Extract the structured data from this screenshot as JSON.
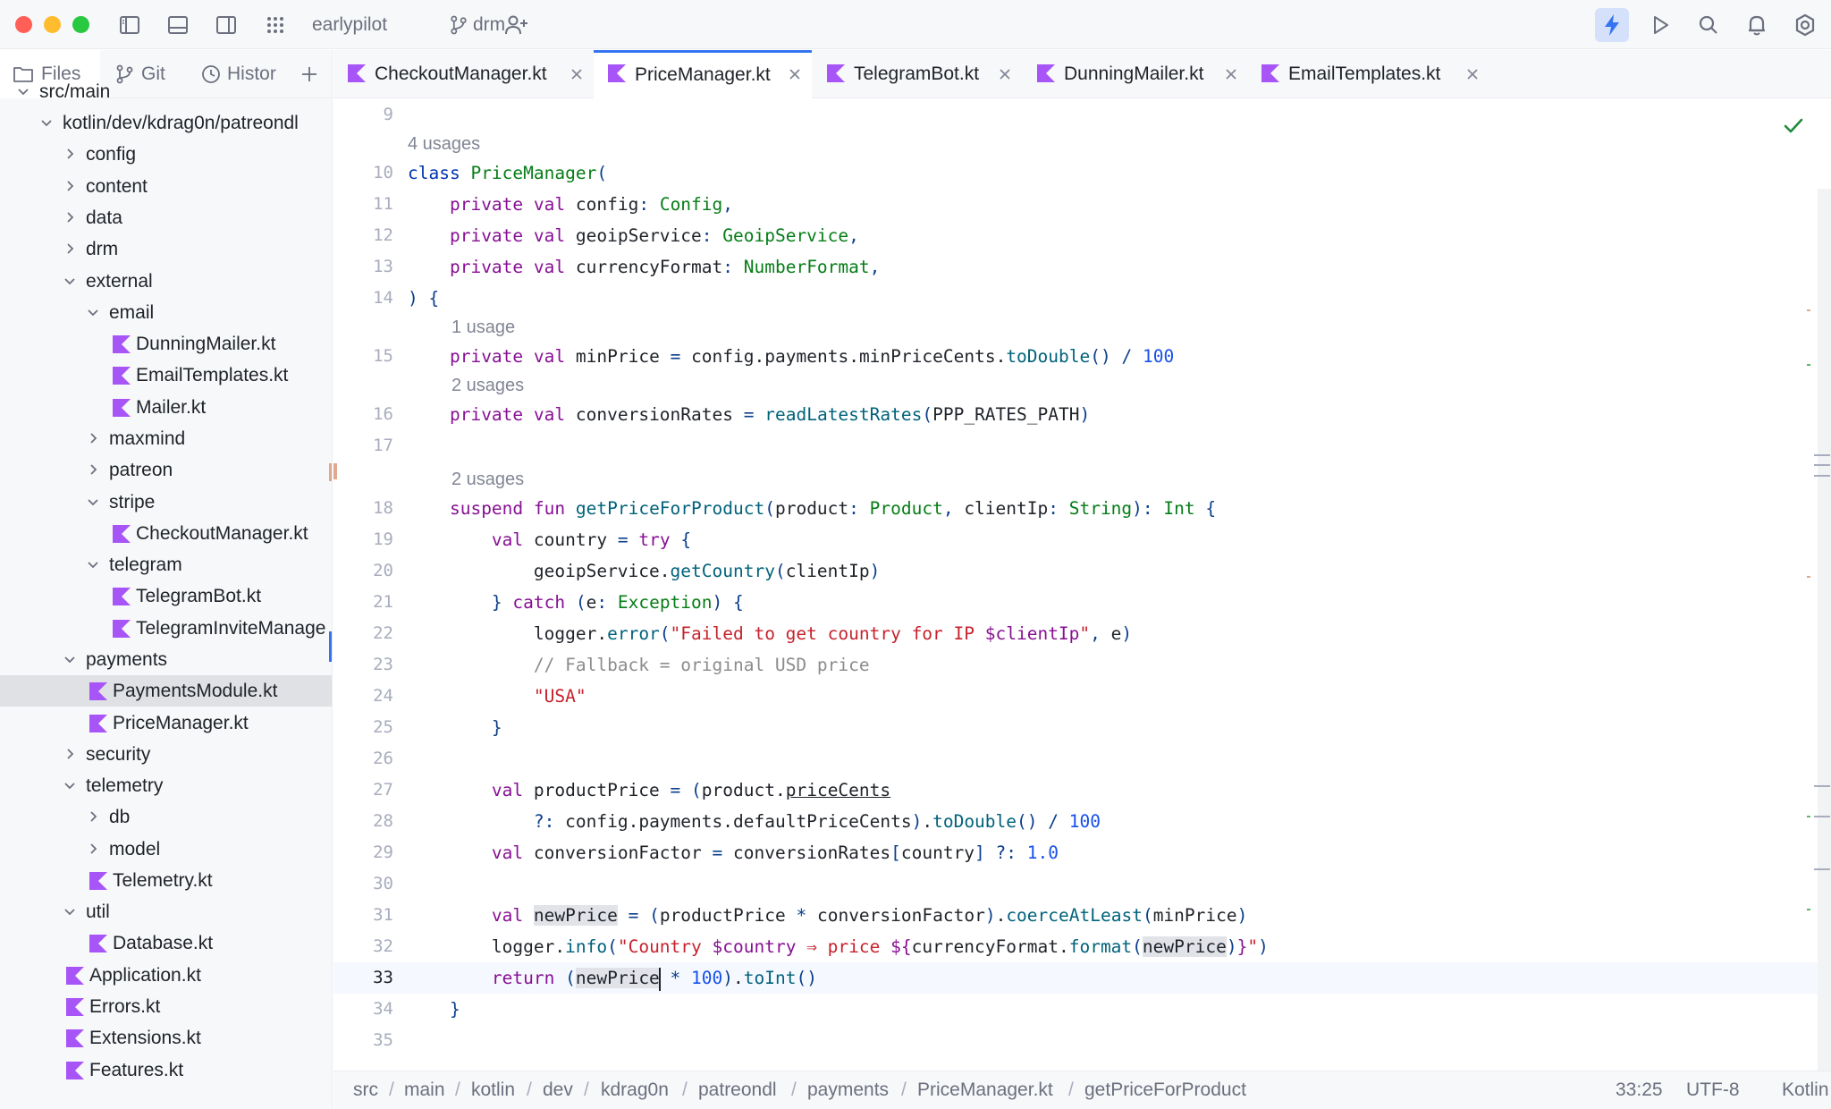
{
  "titlebar": {
    "project": "earlypilot",
    "branch": "drm"
  },
  "panel_tabs": [
    {
      "label": "Files",
      "icon": "folder-icon"
    },
    {
      "label": "Git",
      "icon": "git-branch-icon"
    },
    {
      "label": "Histor",
      "icon": "history-icon"
    }
  ],
  "tree": [
    {
      "label": "src/main",
      "type": "folder",
      "expanded": true,
      "depth": 0
    },
    {
      "label": "kotlin/dev/kdrag0n/patreondl",
      "type": "folder",
      "expanded": true,
      "depth": 1
    },
    {
      "label": "config",
      "type": "folder",
      "expanded": false,
      "depth": 2
    },
    {
      "label": "content",
      "type": "folder",
      "expanded": false,
      "depth": 2
    },
    {
      "label": "data",
      "type": "folder",
      "expanded": false,
      "depth": 2
    },
    {
      "label": "drm",
      "type": "folder",
      "expanded": false,
      "depth": 2
    },
    {
      "label": "external",
      "type": "folder",
      "expanded": true,
      "depth": 2
    },
    {
      "label": "email",
      "type": "folder",
      "expanded": true,
      "depth": 3
    },
    {
      "label": "DunningMailer.kt",
      "type": "file",
      "depth": 4
    },
    {
      "label": "EmailTemplates.kt",
      "type": "file",
      "depth": 4
    },
    {
      "label": "Mailer.kt",
      "type": "file",
      "depth": 4
    },
    {
      "label": "maxmind",
      "type": "folder",
      "expanded": false,
      "depth": 3
    },
    {
      "label": "patreon",
      "type": "folder",
      "expanded": false,
      "depth": 3
    },
    {
      "label": "stripe",
      "type": "folder",
      "expanded": true,
      "depth": 3
    },
    {
      "label": "CheckoutManager.kt",
      "type": "file",
      "depth": 4
    },
    {
      "label": "telegram",
      "type": "folder",
      "expanded": true,
      "depth": 3
    },
    {
      "label": "TelegramBot.kt",
      "type": "file",
      "depth": 4
    },
    {
      "label": "TelegramInviteManage",
      "type": "file",
      "depth": 4
    },
    {
      "label": "payments",
      "type": "folder",
      "expanded": true,
      "depth": 2
    },
    {
      "label": "PaymentsModule.kt",
      "type": "file",
      "depth": 3,
      "state": "hover"
    },
    {
      "label": "PriceManager.kt",
      "type": "file",
      "depth": 3
    },
    {
      "label": "security",
      "type": "folder",
      "expanded": false,
      "depth": 2
    },
    {
      "label": "telemetry",
      "type": "folder",
      "expanded": true,
      "depth": 2
    },
    {
      "label": "db",
      "type": "folder",
      "expanded": false,
      "depth": 3
    },
    {
      "label": "model",
      "type": "folder",
      "expanded": false,
      "depth": 3
    },
    {
      "label": "Telemetry.kt",
      "type": "file",
      "depth": 3
    },
    {
      "label": "util",
      "type": "folder",
      "expanded": true,
      "depth": 2
    },
    {
      "label": "Database.kt",
      "type": "file",
      "depth": 3
    },
    {
      "label": "Application.kt",
      "type": "file",
      "depth": 2
    },
    {
      "label": "Errors.kt",
      "type": "file",
      "depth": 2
    },
    {
      "label": "Extensions.kt",
      "type": "file",
      "depth": 2
    },
    {
      "label": "Features.kt",
      "type": "file",
      "depth": 2
    }
  ],
  "editor_tabs": [
    {
      "label": "CheckoutManager.kt",
      "active": false
    },
    {
      "label": "PriceManager.kt",
      "active": true
    },
    {
      "label": "TelegramBot.kt",
      "active": false
    },
    {
      "label": "DunningMailer.kt",
      "active": false
    },
    {
      "label": "EmailTemplates.kt",
      "active": false
    }
  ],
  "hints": {
    "h1": "4 usages",
    "h2": "1 usage",
    "h3": "2 usages",
    "h4": "2 usages"
  },
  "code": {
    "l9": "9",
    "l10": "10",
    "l11": "11",
    "l12": "12",
    "l13": "13",
    "l14": "14",
    "l15": "15",
    "l16": "16",
    "l17": "17",
    "l18": "18",
    "l19": "19",
    "l20": "20",
    "l21": "21",
    "l22": "22",
    "l23": "23",
    "l24": "24",
    "l25": "25",
    "l26": "26",
    "l27": "27",
    "l28": "28",
    "l29": "29",
    "l30": "30",
    "l31": "31",
    "l32": "32",
    "l33": "33",
    "l34": "34",
    "l35": "35",
    "t": {
      "class": "class",
      "private": "private",
      "val": "val",
      "suspend": "suspend",
      "fun": "fun",
      "try": "try",
      "catch": "catch",
      "return": "return",
      "PriceManager": "PriceManager",
      "config": "config",
      "Config": "Config",
      "geoipService": "geoipService",
      "GeoipService": "GeoipService",
      "currencyFormat": "currencyFormat",
      "NumberFormat": "NumberFormat",
      "minPrice": "minPrice",
      "payments": "payments",
      "minPriceCents": "minPriceCents",
      "toDouble": "toDouble",
      "n100": "100",
      "conversionRates": "conversionRates",
      "readLatestRates": "readLatestRates",
      "PPP_RATES_PATH": "PPP_RATES_PATH",
      "getPriceForProduct": "getPriceForProduct",
      "product": "product",
      "Product": "Product",
      "clientIp": "clientIp",
      "String": "String",
      "Int": "Int",
      "country": "country",
      "getCountry": "getCountry",
      "e": "e",
      "Exception": "Exception",
      "logger": "logger",
      "error": "error",
      "str1": "\"Failed to get country for IP ",
      "dollarClientIp": "$clientIp",
      "strQuote": "\"",
      "comment1": "// Fallback = original USD price",
      "strUSA": "\"USA\"",
      "productPrice": "productPrice",
      "priceCents": "priceCents",
      "defaultPriceCents": "defaultPriceCents",
      "conversionFactor": "conversionFactor",
      "n10": "1.0",
      "newPrice": "newPrice",
      "coerceAtLeast": "coerceAtLeast",
      "info": "info",
      "str2a": "\"Country ",
      "dollarCountry": "$country",
      "str2b": " ⇒ price ",
      "dollarBrace": "${",
      "format": "format",
      "closeBrace": "}",
      "toInt": "toInt"
    }
  },
  "breadcrumb": [
    "src",
    "main",
    "kotlin",
    "dev",
    "kdrag0n",
    "patreondl",
    "payments",
    "PriceManager.kt",
    "getPriceForProduct"
  ],
  "status": {
    "position": "33:25",
    "encoding": "UTF-8",
    "language": "Kotlin"
  },
  "colors": {
    "accent": "#3574f0",
    "kotlin_icon": "#a855f7",
    "check": "#208a3c"
  }
}
